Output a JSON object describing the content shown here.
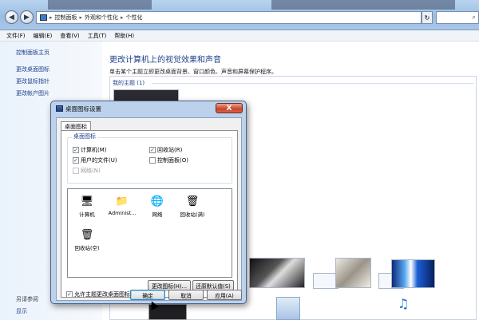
{
  "address": {
    "crumbs": [
      "控制面板",
      "外观和个性化",
      "个性化"
    ],
    "separator": "▸"
  },
  "menu": [
    "文件(F)",
    "编辑(E)",
    "查看(V)",
    "工具(T)",
    "帮助(H)"
  ],
  "left_pane": {
    "home": "控制面板主页",
    "links": [
      "更改桌面图标",
      "更改鼠标指针",
      "更改帐户图片"
    ],
    "see_also_header": "另请参阅",
    "see_also": [
      "显示"
    ]
  },
  "main": {
    "title": "更改计算机上的视觉效果和声音",
    "subtitle": "单击某个主题立即更改桌面背景、窗口颜色、声音和屏幕保护程序。",
    "my_themes": "我的主题 (1)"
  },
  "dialog": {
    "title": "桌面图标设置",
    "close": "X",
    "tab": "桌面图标",
    "group_label": "桌面图标",
    "checkboxes": [
      {
        "label": "计算机(M)",
        "checked": true,
        "enabled": true
      },
      {
        "label": "回收站(R)",
        "checked": true,
        "enabled": true
      },
      {
        "label": "用户的文件(U)",
        "checked": true,
        "enabled": true
      },
      {
        "label": "控制面板(O)",
        "checked": false,
        "enabled": true
      },
      {
        "label": "网络(N)",
        "checked": false,
        "enabled": false
      }
    ],
    "icons": [
      {
        "label": "计算机",
        "icon": "computer-icon",
        "glyph": "🖥"
      },
      {
        "label": "Administ...",
        "icon": "user-folder-icon",
        "glyph": "📁"
      },
      {
        "label": "网络",
        "icon": "network-icon",
        "glyph": "🌐"
      },
      {
        "label": "回收站(满)",
        "icon": "recycle-bin-full-icon",
        "glyph": "🗑"
      },
      {
        "label": "回收站(空)",
        "icon": "recycle-bin-empty-icon",
        "glyph": "🗑"
      }
    ],
    "change_icon": "更改图标(H)...",
    "restore_default": "还原默认值(S)",
    "allow_themes": "允许主题更改桌面图标(L)",
    "allow_themes_checked": true,
    "ok": "确定",
    "cancel": "取消",
    "apply": "应用(A)"
  },
  "colors": {
    "link": "#1e3f8a",
    "dialog_frame": "#bcd2ec",
    "close_button": "#c8442b"
  }
}
